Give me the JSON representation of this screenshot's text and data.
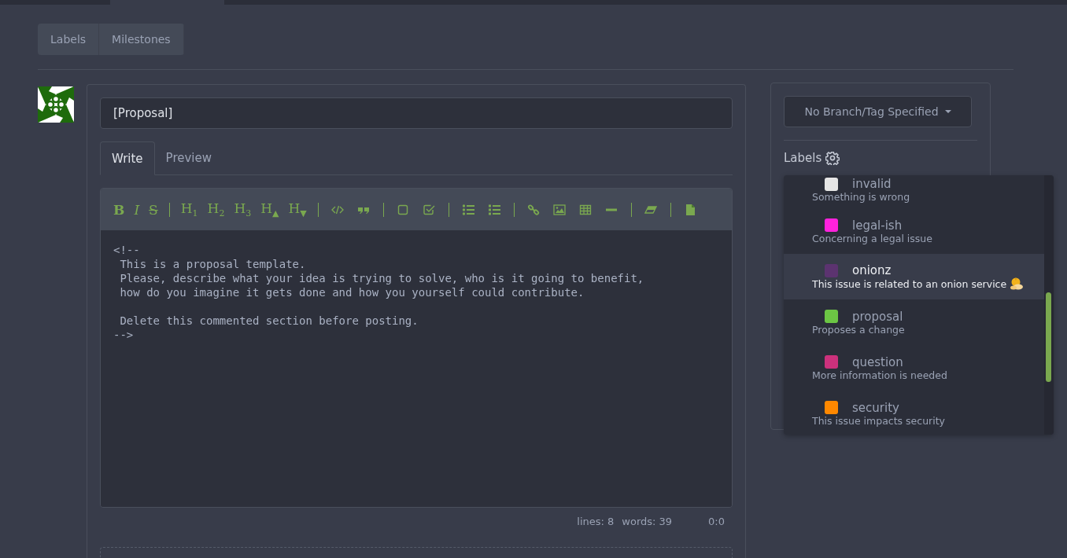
{
  "nav_buttons": [
    {
      "label": "Labels"
    },
    {
      "label": "Milestones"
    }
  ],
  "title_field": {
    "value": "[Proposal]"
  },
  "editor_tabs": [
    {
      "label": "Write",
      "selected": true
    },
    {
      "label": "Preview",
      "selected": false
    }
  ],
  "toolbar": [
    [
      {
        "kind": "bold",
        "label": "B"
      },
      {
        "kind": "italic",
        "label": "I"
      },
      {
        "kind": "strike",
        "label": "S"
      }
    ],
    [
      {
        "kind": "heading",
        "label": "H$_{1}$"
      },
      {
        "kind": "heading",
        "label": "H$_{2}$"
      },
      {
        "kind": "heading",
        "label": "H$_{3}$"
      },
      {
        "kind": "heading",
        "label": "H$_{▲}$"
      },
      {
        "kind": "heading",
        "label": "H$_{▼}$"
      }
    ],
    [
      {
        "kind": "code"
      },
      {
        "kind": "quote"
      }
    ],
    [
      {
        "kind": "checkbox"
      },
      {
        "kind": "checkbox-checked"
      }
    ],
    [
      {
        "kind": "bullet-list"
      },
      {
        "kind": "numbered-list"
      }
    ],
    [
      {
        "kind": "link"
      },
      {
        "kind": "image"
      },
      {
        "kind": "table"
      },
      {
        "kind": "rule"
      }
    ],
    [
      {
        "kind": "eraser"
      }
    ],
    [
      {
        "kind": "file"
      }
    ]
  ],
  "editor_text": "<!--\n This is a proposal template.\n Please, describe what your idea is trying to solve, who is it going to benefit,\n how do you imagine it gets done and how you yourself could contribute.\n\n Delete this commented section before posting.\n-->",
  "status": {
    "lines": "lines: 8",
    "words": "words: 39",
    "cursor": "0:0"
  },
  "branch_button": {
    "label": "No Branch/Tag Specified"
  },
  "labels_heading": "Labels",
  "label_options": [
    {
      "name": "invalid",
      "description": "Something is wrong",
      "color": "#e6e6e6",
      "highlighted": false,
      "emoji": false
    },
    {
      "name": "legal-ish",
      "description": "Concerning a legal issue",
      "color": "#ff22dd",
      "highlighted": false,
      "emoji": false
    },
    {
      "name": "onionz",
      "description": "This issue is related to an onion service",
      "color": "#5c3370",
      "highlighted": true,
      "emoji": true
    },
    {
      "name": "proposal",
      "description": "Proposes a change",
      "color": "#6cc644",
      "highlighted": false,
      "emoji": false
    },
    {
      "name": "question",
      "description": "More information is needed",
      "color": "#cc317c",
      "highlighted": false,
      "emoji": false
    },
    {
      "name": "security",
      "description": "This issue impacts security",
      "color": "#ff8800",
      "highlighted": false,
      "emoji": false
    }
  ]
}
